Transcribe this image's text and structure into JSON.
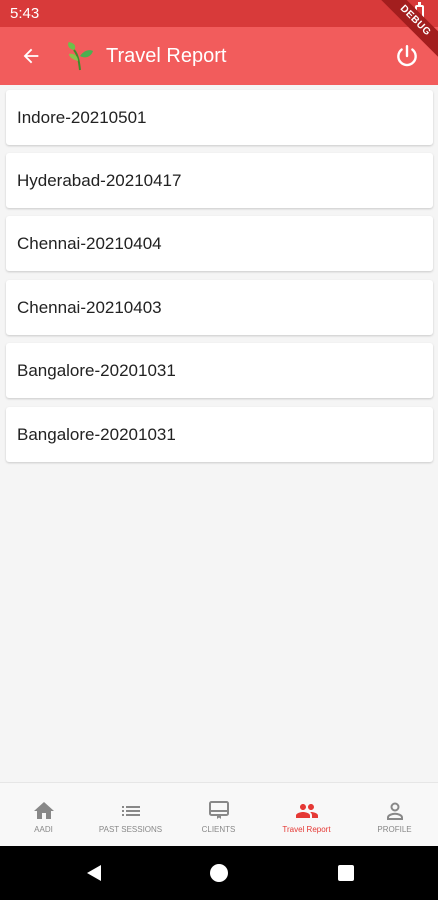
{
  "status_bar": {
    "time": "5:43"
  },
  "debug_banner": "DEBUG",
  "app_bar": {
    "title": "Travel Report"
  },
  "reports": [
    {
      "label": "Indore-20210501"
    },
    {
      "label": "Hyderabad-20210417"
    },
    {
      "label": "Chennai-20210404"
    },
    {
      "label": "Chennai-20210403"
    },
    {
      "label": "Bangalore-20201031"
    },
    {
      "label": "Bangalore-20201031"
    }
  ],
  "bottom_nav": {
    "items": [
      {
        "label": "AADI",
        "icon": "home-icon"
      },
      {
        "label": "PAST SESSIONS",
        "icon": "list-icon"
      },
      {
        "label": "CLIENTS",
        "icon": "clients-icon"
      },
      {
        "label": "Travel Report",
        "icon": "people-icon",
        "active": true
      },
      {
        "label": "PROFILE",
        "icon": "person-icon"
      }
    ]
  },
  "colors": {
    "status_bar": "#d83a3a",
    "app_bar": "#f25c5c",
    "active": "#e53935",
    "inactive": "#888888"
  }
}
